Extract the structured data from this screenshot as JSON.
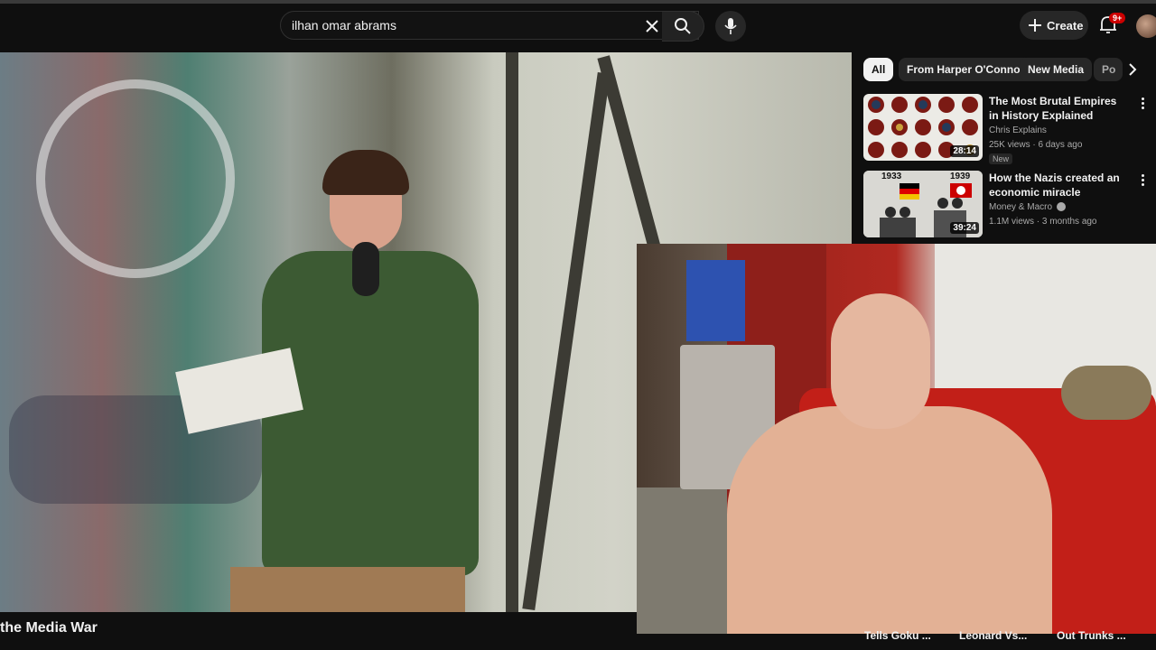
{
  "search": {
    "query": "ilhan omar abrams"
  },
  "header": {
    "create_label": "Create",
    "notifications_badge": "9+"
  },
  "video": {
    "title": "the Media War"
  },
  "chips": [
    "All",
    "From Harper O'Connor",
    "New Media",
    "Po"
  ],
  "recommendations": [
    {
      "title": "The Most Brutal Empires in History Explained",
      "channel": "Chris Explains",
      "meta": "25K views · 6 days ago",
      "badge": "New",
      "duration": "28:14"
    },
    {
      "title": "How the Nazis created an economic miracle",
      "channel": "Money & Macro",
      "meta": "1.1M views · 3 months ago",
      "duration": "39:24",
      "thumb_years": [
        "1933",
        "1939"
      ]
    }
  ],
  "bottom_titles": [
    "Tells Goku ...",
    "Leonard Vs...",
    "Out Trunks ..."
  ],
  "colors": {
    "background": "#0f0f0f",
    "chip_active": "#f1f1f1",
    "badge": "#cc0000",
    "text_secondary": "#aaaaaa"
  },
  "icons": [
    "clear-icon",
    "search-icon",
    "mic-icon",
    "plus-icon",
    "bell-icon",
    "chevron-right-icon",
    "more-vert-icon",
    "verified-icon"
  ]
}
